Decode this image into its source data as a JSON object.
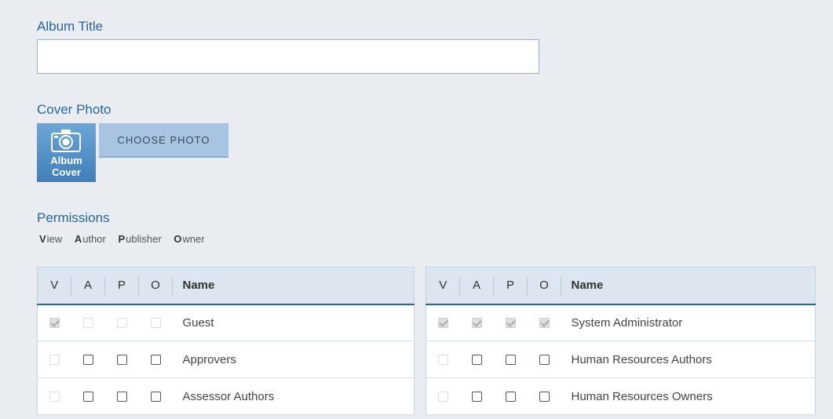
{
  "form": {
    "album_title_label": "Album Title",
    "album_title_value": "",
    "cover_photo_label": "Cover Photo",
    "cover_thumb_text_line1": "Album",
    "cover_thumb_text_line2": "Cover",
    "choose_photo_label": "CHOOSE PHOTO",
    "permissions_label": "Permissions"
  },
  "legend": [
    {
      "key": "V",
      "rest": "iew"
    },
    {
      "key": "A",
      "rest": "uthor"
    },
    {
      "key": "P",
      "rest": "ublisher"
    },
    {
      "key": "O",
      "rest": "wner"
    }
  ],
  "table_headers": {
    "v": "V",
    "a": "A",
    "p": "P",
    "o": "O",
    "name": "Name"
  },
  "left_rows": [
    {
      "name": "Guest",
      "v": "checked-disabled",
      "a": "disabled",
      "p": "disabled",
      "o": "disabled"
    },
    {
      "name": "Approvers",
      "v": "disabled",
      "a": "unchecked",
      "p": "unchecked",
      "o": "unchecked"
    },
    {
      "name": "Assessor Authors",
      "v": "disabled",
      "a": "unchecked",
      "p": "unchecked",
      "o": "unchecked"
    }
  ],
  "right_rows": [
    {
      "name": "System Administrator",
      "v": "checked-disabled",
      "a": "checked-disabled",
      "p": "checked-disabled",
      "o": "checked-disabled"
    },
    {
      "name": "Human Resources Authors",
      "v": "disabled",
      "a": "unchecked",
      "p": "unchecked",
      "o": "unchecked"
    },
    {
      "name": "Human Resources Owners",
      "v": "disabled",
      "a": "unchecked",
      "p": "unchecked",
      "o": "unchecked"
    }
  ],
  "colors": {
    "accent": "#2a6496",
    "background": "#e9edf2",
    "button": "#a9c4e2"
  },
  "icons": {
    "cover": "camera-icon"
  }
}
